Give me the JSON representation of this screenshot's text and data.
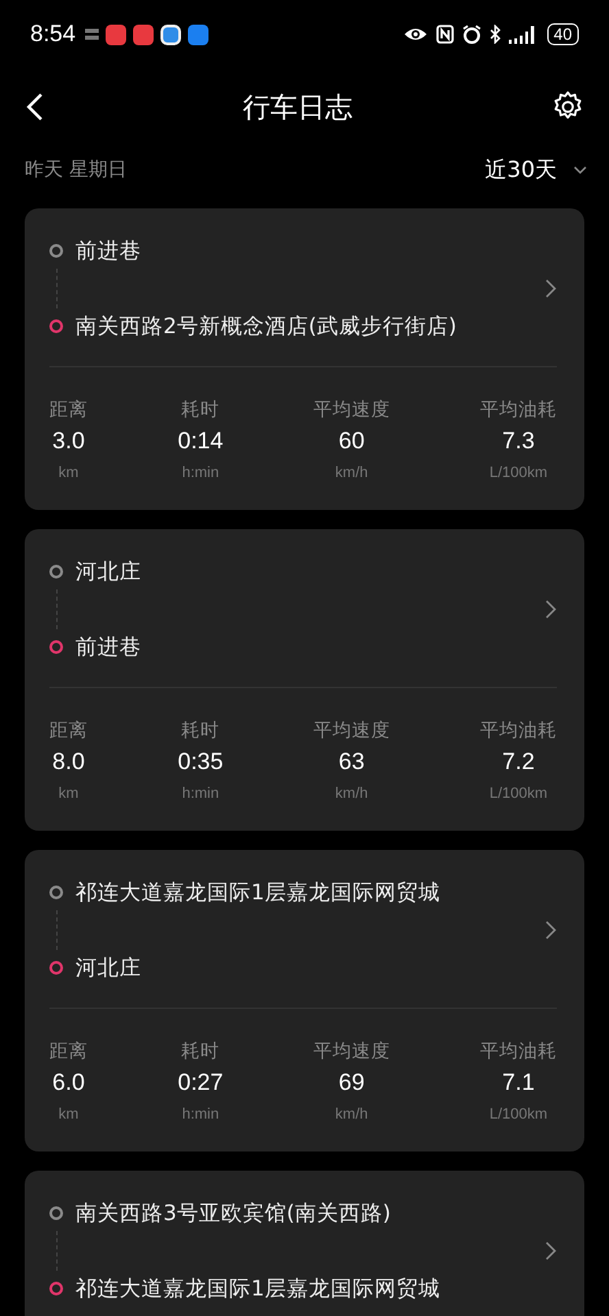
{
  "status_bar": {
    "time": "8:54",
    "battery": "40"
  },
  "header": {
    "title": "行车日志"
  },
  "filter": {
    "date": "昨天 星期日",
    "range": "近30天"
  },
  "trips": [
    {
      "from": "前进巷",
      "to": "南关西路2号新概念酒店(武威步行街店)",
      "stats": [
        {
          "label": "距离",
          "value": "3.0",
          "unit": "km"
        },
        {
          "label": "耗时",
          "value": "0:14",
          "unit": "h:min"
        },
        {
          "label": "平均速度",
          "value": "60",
          "unit": "km/h"
        },
        {
          "label": "平均油耗",
          "value": "7.3",
          "unit": "L/100km"
        }
      ]
    },
    {
      "from": "河北庄",
      "to": "前进巷",
      "stats": [
        {
          "label": "距离",
          "value": "8.0",
          "unit": "km"
        },
        {
          "label": "耗时",
          "value": "0:35",
          "unit": "h:min"
        },
        {
          "label": "平均速度",
          "value": "63",
          "unit": "km/h"
        },
        {
          "label": "平均油耗",
          "value": "7.2",
          "unit": "L/100km"
        }
      ]
    },
    {
      "from": "祁连大道嘉龙国际1层嘉龙国际网贸城",
      "to": "河北庄",
      "stats": [
        {
          "label": "距离",
          "value": "6.0",
          "unit": "km"
        },
        {
          "label": "耗时",
          "value": "0:27",
          "unit": "h:min"
        },
        {
          "label": "平均速度",
          "value": "69",
          "unit": "km/h"
        },
        {
          "label": "平均油耗",
          "value": "7.1",
          "unit": "L/100km"
        }
      ]
    },
    {
      "from": "南关西路3号亚欧宾馆(南关西路)",
      "to": "祁连大道嘉龙国际1层嘉龙国际网贸城"
    }
  ]
}
